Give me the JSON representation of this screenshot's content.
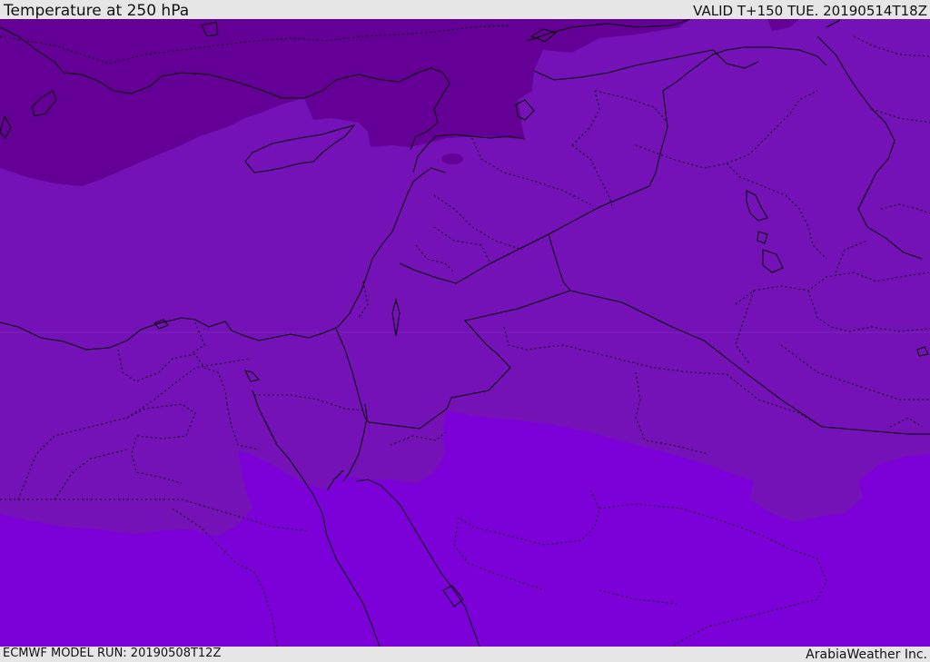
{
  "header": {
    "title": "Temperature at 250 hPa",
    "valid": "VALID T+150 TUE. 20190514T18Z"
  },
  "footer": {
    "model_run": "ECMWF MODEL RUN: 20190508T12Z",
    "credit": "ArabiaWeather Inc."
  },
  "map": {
    "colors": {
      "coldest": "#650096",
      "cold": "#7510b3",
      "mid": "#7412b8",
      "warm": "#7c00d8",
      "coastline": "#000000",
      "border": "#000000"
    }
  }
}
